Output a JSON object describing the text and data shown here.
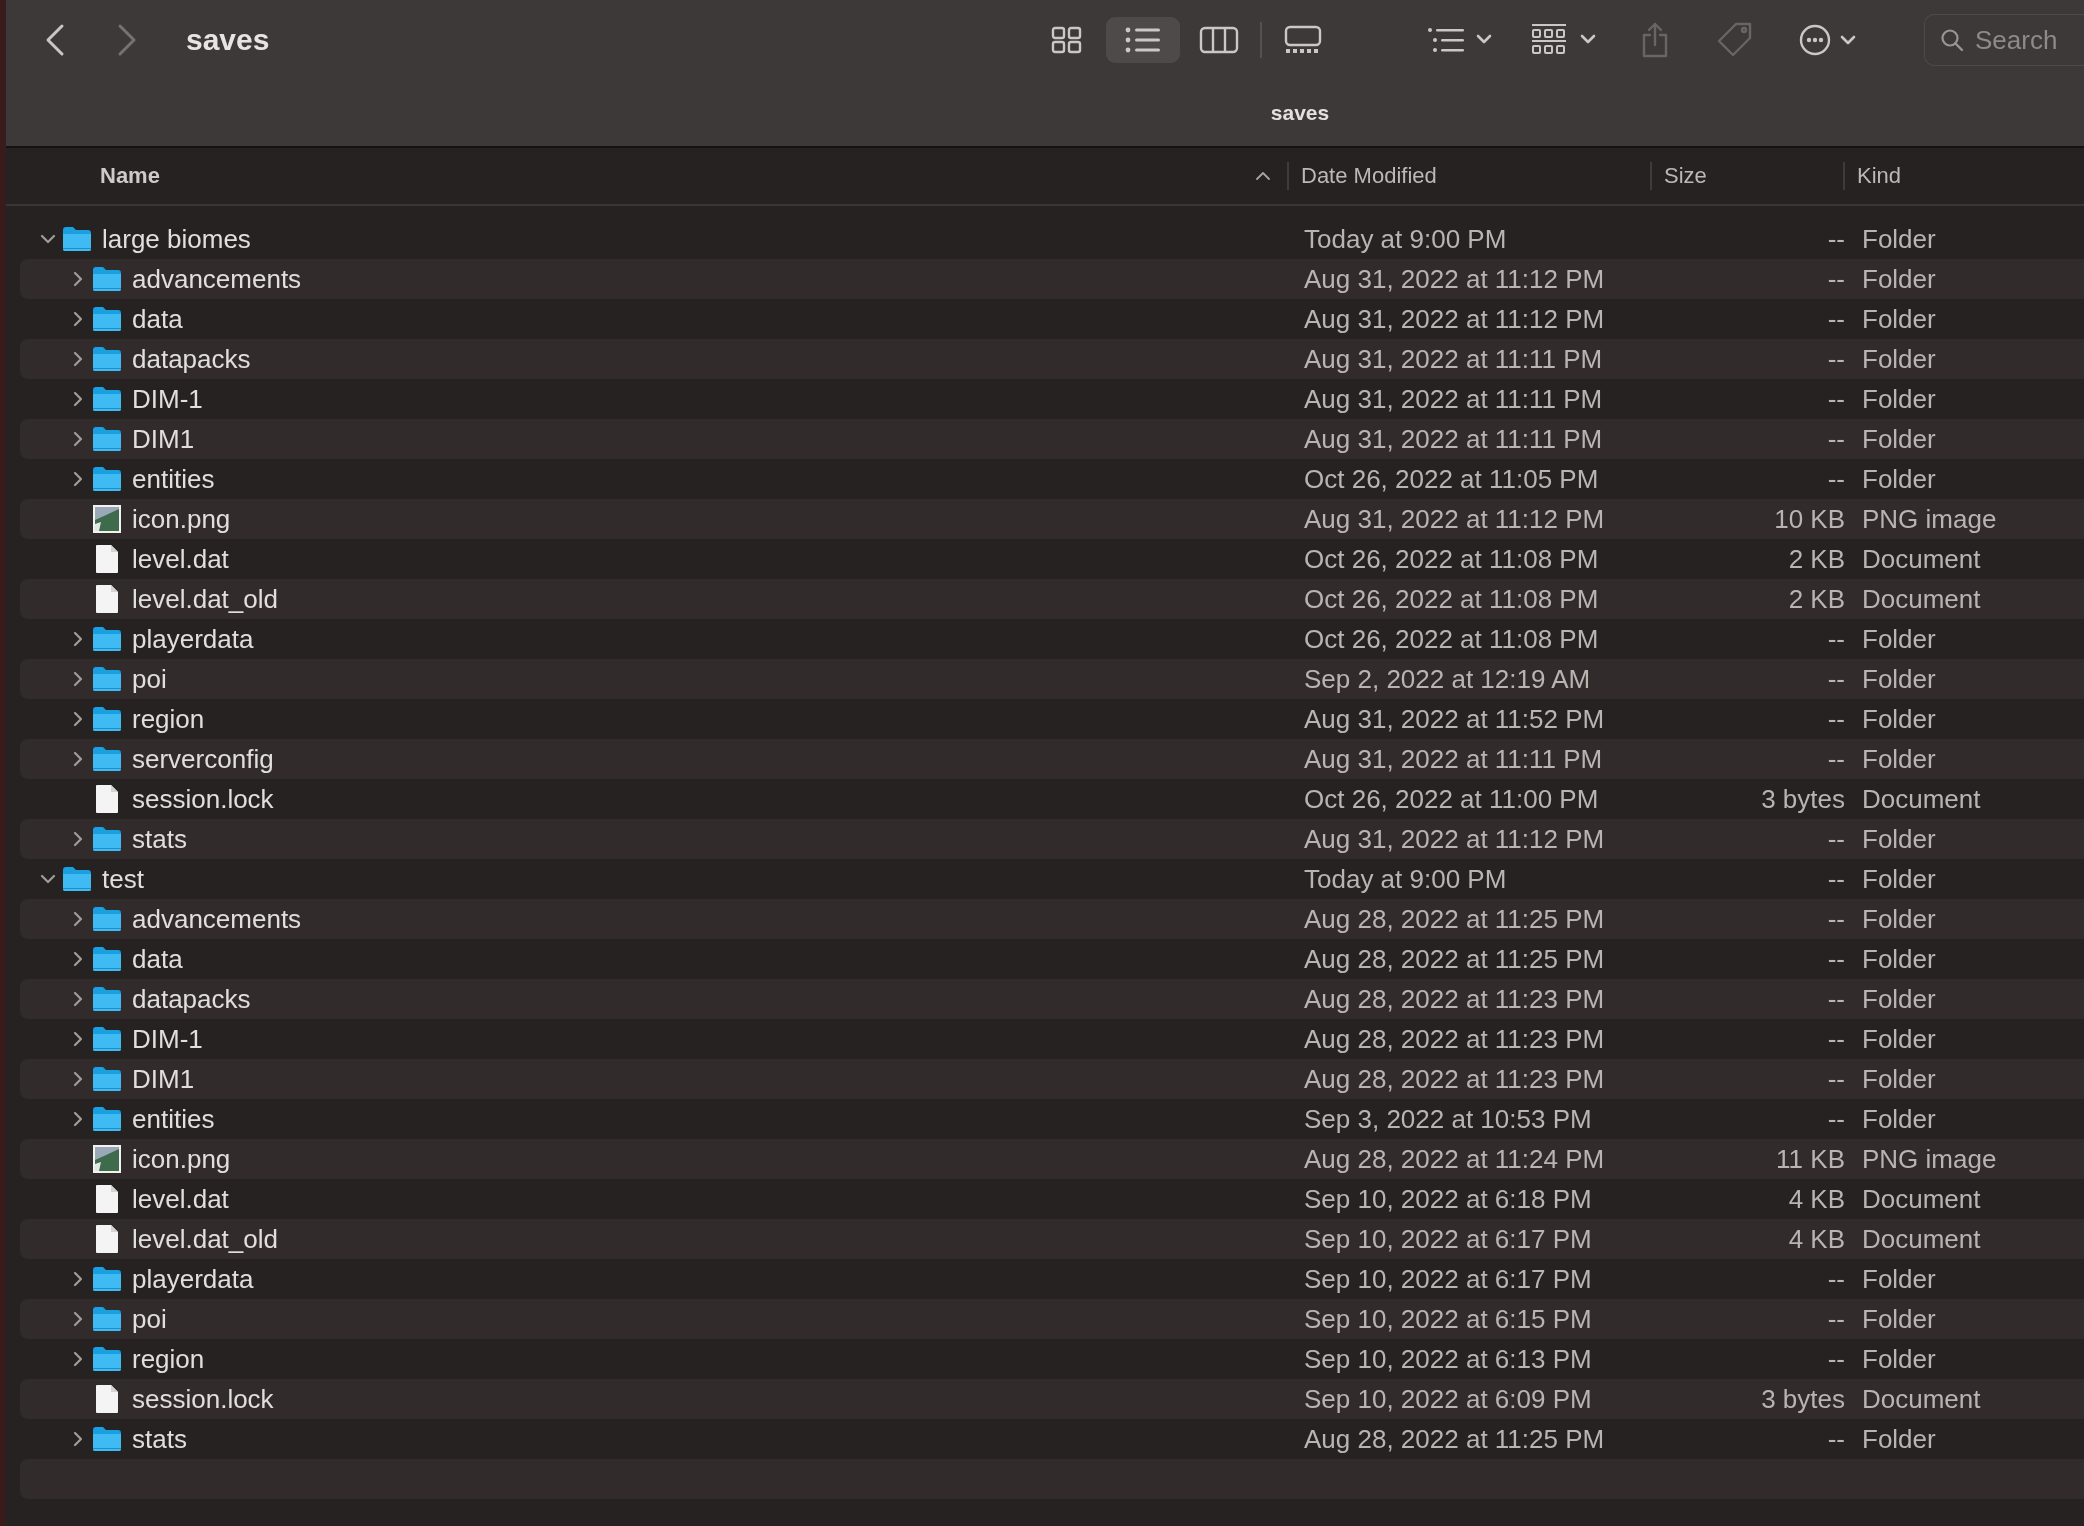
{
  "toolbar": {
    "title": "saves",
    "back": {
      "disabled": false
    },
    "forward": {
      "disabled": true
    },
    "view_modes": [
      {
        "kind": "icons",
        "selected": false
      },
      {
        "kind": "list",
        "selected": true
      },
      {
        "kind": "columns",
        "selected": false
      },
      {
        "kind": "gallery",
        "selected": false
      }
    ],
    "actions": [
      {
        "kind": "group",
        "disabled": false
      },
      {
        "kind": "arrange",
        "disabled": false
      },
      {
        "kind": "share",
        "disabled": true
      },
      {
        "kind": "tag",
        "disabled": true
      },
      {
        "kind": "more",
        "disabled": false
      }
    ],
    "search": {
      "placeholder": "Search"
    }
  },
  "path_title": "saves",
  "table": {
    "columns": [
      {
        "label": "Name",
        "sorted": true
      },
      {
        "label": "Date Modified",
        "sorted": false
      },
      {
        "label": "Size",
        "sorted": false
      },
      {
        "label": "Kind",
        "sorted": false
      }
    ],
    "rows": [
      {
        "name": "large biomes",
        "kind": "folder",
        "expanded": true,
        "date": "Today at 9:00 PM",
        "size": "--",
        "type": "Folder",
        "children": [
          {
            "name": "advancements",
            "kind": "folder",
            "expanded": false,
            "date": "Aug 31, 2022 at 11:12 PM",
            "size": "--",
            "type": "Folder"
          },
          {
            "name": "data",
            "kind": "folder",
            "expanded": false,
            "date": "Aug 31, 2022 at 11:12 PM",
            "size": "--",
            "type": "Folder"
          },
          {
            "name": "datapacks",
            "kind": "folder",
            "expanded": false,
            "date": "Aug 31, 2022 at 11:11 PM",
            "size": "--",
            "type": "Folder"
          },
          {
            "name": "DIM-1",
            "kind": "folder",
            "expanded": false,
            "date": "Aug 31, 2022 at 11:11 PM",
            "size": "--",
            "type": "Folder"
          },
          {
            "name": "DIM1",
            "kind": "folder",
            "expanded": false,
            "date": "Aug 31, 2022 at 11:11 PM",
            "size": "--",
            "type": "Folder"
          },
          {
            "name": "entities",
            "kind": "folder",
            "expanded": false,
            "date": "Oct 26, 2022 at 11:05 PM",
            "size": "--",
            "type": "Folder"
          },
          {
            "name": "icon.png",
            "kind": "image",
            "date": "Aug 31, 2022 at 11:12 PM",
            "size": "10 KB",
            "type": "PNG image"
          },
          {
            "name": "level.dat",
            "kind": "document",
            "date": "Oct 26, 2022 at 11:08 PM",
            "size": "2 KB",
            "type": "Document"
          },
          {
            "name": "level.dat_old",
            "kind": "document",
            "date": "Oct 26, 2022 at 11:08 PM",
            "size": "2 KB",
            "type": "Document"
          },
          {
            "name": "playerdata",
            "kind": "folder",
            "expanded": false,
            "date": "Oct 26, 2022 at 11:08 PM",
            "size": "--",
            "type": "Folder"
          },
          {
            "name": "poi",
            "kind": "folder",
            "expanded": false,
            "date": "Sep 2, 2022 at 12:19 AM",
            "size": "--",
            "type": "Folder"
          },
          {
            "name": "region",
            "kind": "folder",
            "expanded": false,
            "date": "Aug 31, 2022 at 11:52 PM",
            "size": "--",
            "type": "Folder"
          },
          {
            "name": "serverconfig",
            "kind": "folder",
            "expanded": false,
            "date": "Aug 31, 2022 at 11:11 PM",
            "size": "--",
            "type": "Folder"
          },
          {
            "name": "session.lock",
            "kind": "document",
            "date": "Oct 26, 2022 at 11:00 PM",
            "size": "3 bytes",
            "type": "Document"
          },
          {
            "name": "stats",
            "kind": "folder",
            "expanded": false,
            "date": "Aug 31, 2022 at 11:12 PM",
            "size": "--",
            "type": "Folder"
          }
        ]
      },
      {
        "name": "test",
        "kind": "folder",
        "expanded": true,
        "date": "Today at 9:00 PM",
        "size": "--",
        "type": "Folder",
        "children": [
          {
            "name": "advancements",
            "kind": "folder",
            "expanded": false,
            "date": "Aug 28, 2022 at 11:25 PM",
            "size": "--",
            "type": "Folder"
          },
          {
            "name": "data",
            "kind": "folder",
            "expanded": false,
            "date": "Aug 28, 2022 at 11:25 PM",
            "size": "--",
            "type": "Folder"
          },
          {
            "name": "datapacks",
            "kind": "folder",
            "expanded": false,
            "date": "Aug 28, 2022 at 11:23 PM",
            "size": "--",
            "type": "Folder"
          },
          {
            "name": "DIM-1",
            "kind": "folder",
            "expanded": false,
            "date": "Aug 28, 2022 at 11:23 PM",
            "size": "--",
            "type": "Folder"
          },
          {
            "name": "DIM1",
            "kind": "folder",
            "expanded": false,
            "date": "Aug 28, 2022 at 11:23 PM",
            "size": "--",
            "type": "Folder"
          },
          {
            "name": "entities",
            "kind": "folder",
            "expanded": false,
            "date": "Sep 3, 2022 at 10:53 PM",
            "size": "--",
            "type": "Folder"
          },
          {
            "name": "icon.png",
            "kind": "image",
            "date": "Aug 28, 2022 at 11:24 PM",
            "size": "11 KB",
            "type": "PNG image"
          },
          {
            "name": "level.dat",
            "kind": "document",
            "date": "Sep 10, 2022 at 6:18 PM",
            "size": "4 KB",
            "type": "Document"
          },
          {
            "name": "level.dat_old",
            "kind": "document",
            "date": "Sep 10, 2022 at 6:17 PM",
            "size": "4 KB",
            "type": "Document"
          },
          {
            "name": "playerdata",
            "kind": "folder",
            "expanded": false,
            "date": "Sep 10, 2022 at 6:17 PM",
            "size": "--",
            "type": "Folder"
          },
          {
            "name": "poi",
            "kind": "folder",
            "expanded": false,
            "date": "Sep 10, 2022 at 6:15 PM",
            "size": "--",
            "type": "Folder"
          },
          {
            "name": "region",
            "kind": "folder",
            "expanded": false,
            "date": "Sep 10, 2022 at 6:13 PM",
            "size": "--",
            "type": "Folder"
          },
          {
            "name": "session.lock",
            "kind": "document",
            "date": "Sep 10, 2022 at 6:09 PM",
            "size": "3 bytes",
            "type": "Document"
          },
          {
            "name": "stats",
            "kind": "folder",
            "expanded": false,
            "date": "Aug 28, 2022 at 11:25 PM",
            "size": "--",
            "type": "Folder"
          }
        ]
      }
    ]
  }
}
